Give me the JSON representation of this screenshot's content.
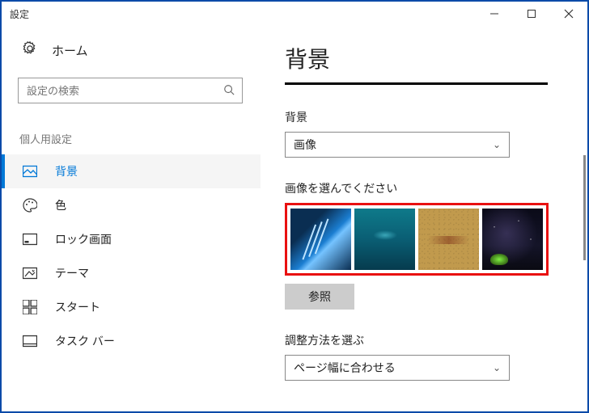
{
  "window": {
    "title": "設定"
  },
  "home": {
    "label": "ホーム"
  },
  "search": {
    "placeholder": "設定の検索"
  },
  "sidebar": {
    "category": "個人用設定",
    "items": [
      {
        "label": "背景"
      },
      {
        "label": "色"
      },
      {
        "label": "ロック画面"
      },
      {
        "label": "テーマ"
      },
      {
        "label": "スタート"
      },
      {
        "label": "タスク バー"
      }
    ]
  },
  "main": {
    "title": "背景",
    "bg_section_label": "背景",
    "bg_select_value": "画像",
    "choose_image_label": "画像を選んでください",
    "browse_label": "参照",
    "fit_label": "調整方法を選ぶ",
    "fit_select_value": "ページ幅に合わせる"
  }
}
